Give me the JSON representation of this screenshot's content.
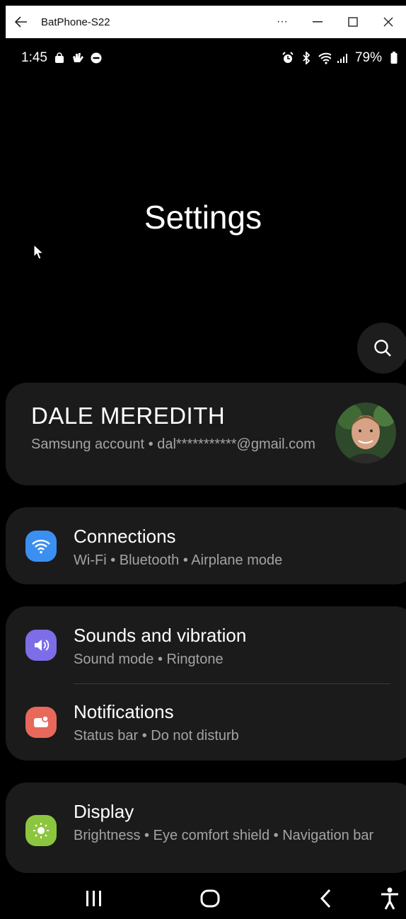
{
  "window": {
    "title": "BatPhone-S22"
  },
  "status": {
    "time": "1:45",
    "battery": "79%"
  },
  "page": {
    "title": "Settings"
  },
  "profile": {
    "name": "DALE MEREDITH",
    "account": "Samsung account  •  dal***********@gmail.com"
  },
  "items": [
    {
      "label": "Connections",
      "sub": "Wi-Fi  •  Bluetooth  •  Airplane mode",
      "color": "#3b8ff0"
    },
    {
      "label": "Sounds and vibration",
      "sub": "Sound mode  •  Ringtone",
      "color": "#7d6ee8"
    },
    {
      "label": "Notifications",
      "sub": "Status bar  •  Do not disturb",
      "color": "#e8685a"
    },
    {
      "label": "Display",
      "sub": "Brightness  •  Eye comfort shield  •  Navigation bar",
      "color": "#8cc63f"
    }
  ],
  "icons": {
    "back": "arrow-left-icon",
    "more": "more-horizontal-icon",
    "minimize": "minimize-icon",
    "maximize": "maximize-icon",
    "close": "close-icon",
    "search": "search-icon",
    "recents": "recents-icon",
    "home": "home-icon",
    "nav_back": "chevron-left-icon",
    "accessibility": "accessibility-icon"
  }
}
